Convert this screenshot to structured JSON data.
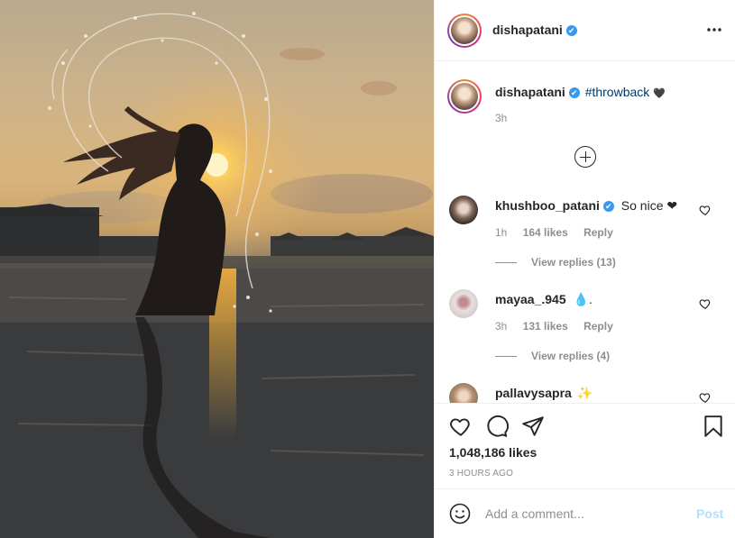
{
  "post": {
    "image_alt": "silhouette hair flip at sunset in water"
  },
  "header": {
    "username": "dishapatani",
    "verified": "✔",
    "more_icon": "more-options-icon"
  },
  "caption": {
    "username": "dishapatani",
    "verified": "✔",
    "text": "#throwback",
    "emoji": "🖤",
    "time": "3h"
  },
  "comments": [
    {
      "username": "khushboo_patani",
      "verified": "✔",
      "text": "So nice ❤",
      "time": "1h",
      "likes": "164 likes",
      "reply": "Reply",
      "view_replies": "View replies (13)"
    },
    {
      "username": "mayaa_.945",
      "text": "💧.",
      "time": "3h",
      "likes": "131 likes",
      "reply": "Reply",
      "view_replies": "View replies (4)"
    },
    {
      "username": "pallavysapra",
      "text": "✨"
    }
  ],
  "actions": {
    "likes": "1,048,186 likes",
    "posted": "3 HOURS AGO"
  },
  "add_comment": {
    "placeholder": "Add a comment...",
    "post_label": "Post"
  },
  "colors": {
    "accent": "#3897f0",
    "link": "#00376b",
    "muted": "#8e8e8e",
    "post_disabled": "#b2dffc"
  }
}
